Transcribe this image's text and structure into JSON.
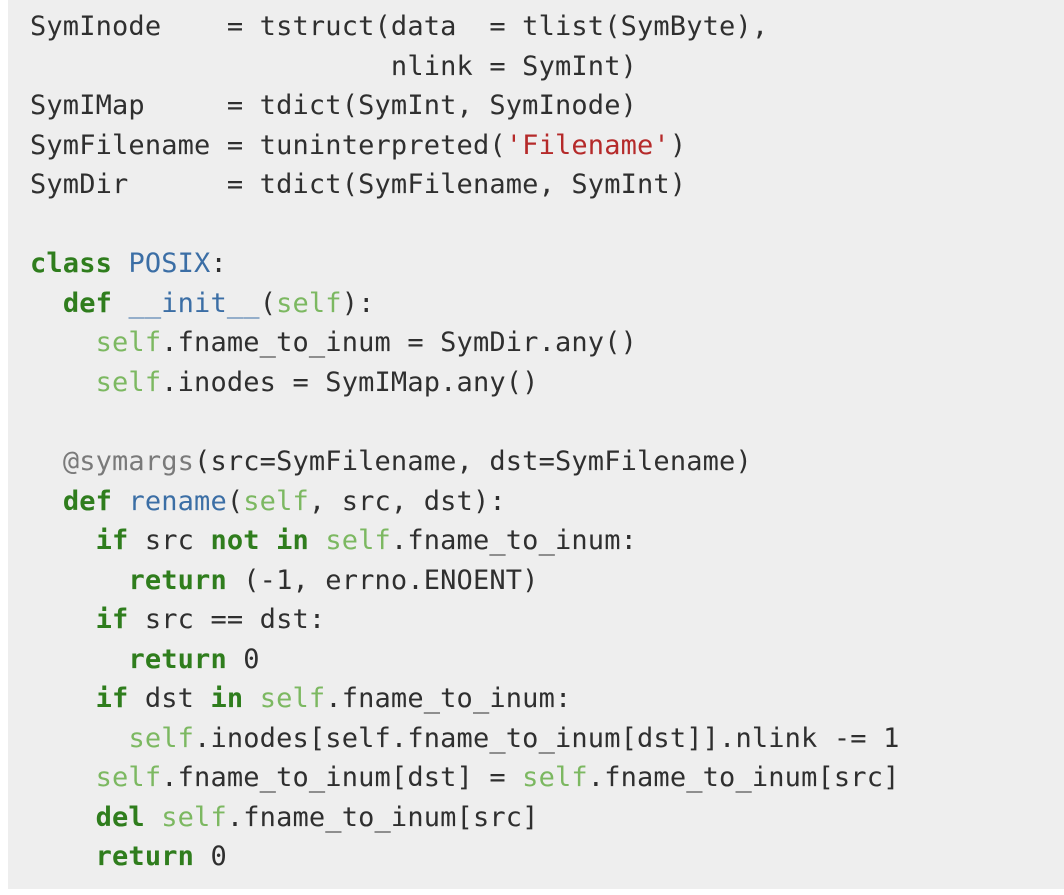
{
  "code": {
    "lines": [
      [
        {
          "t": "SymInode    = tstruct(data  = tlist(SymByte),",
          "c": ""
        }
      ],
      [
        {
          "t": "                      nlink = SymInt)",
          "c": ""
        }
      ],
      [
        {
          "t": "SymIMap     = tdict(SymInt, SymInode)",
          "c": ""
        }
      ],
      [
        {
          "t": "SymFilename = tuninterpreted(",
          "c": ""
        },
        {
          "t": "'Filename'",
          "c": "str"
        },
        {
          "t": ")",
          "c": ""
        }
      ],
      [
        {
          "t": "SymDir      = tdict(SymFilename, SymInt)",
          "c": ""
        }
      ],
      [
        {
          "t": "",
          "c": ""
        }
      ],
      [
        {
          "t": "class",
          "c": "kw"
        },
        {
          "t": " ",
          "c": ""
        },
        {
          "t": "POSIX",
          "c": "def-name"
        },
        {
          "t": ":",
          "c": ""
        }
      ],
      [
        {
          "t": "  ",
          "c": ""
        },
        {
          "t": "def",
          "c": "kw"
        },
        {
          "t": " ",
          "c": ""
        },
        {
          "t": "__init__",
          "c": "def-name"
        },
        {
          "t": "(",
          "c": ""
        },
        {
          "t": "self",
          "c": "selfkw"
        },
        {
          "t": "):",
          "c": ""
        }
      ],
      [
        {
          "t": "    ",
          "c": ""
        },
        {
          "t": "self",
          "c": "selfkw"
        },
        {
          "t": ".fname_to_inum = SymDir.any()",
          "c": ""
        }
      ],
      [
        {
          "t": "    ",
          "c": ""
        },
        {
          "t": "self",
          "c": "selfkw"
        },
        {
          "t": ".inodes = SymIMap.any()",
          "c": ""
        }
      ],
      [
        {
          "t": "",
          "c": ""
        }
      ],
      [
        {
          "t": "  ",
          "c": ""
        },
        {
          "t": "@symargs",
          "c": "deco"
        },
        {
          "t": "(src=SymFilename, dst=SymFilename)",
          "c": ""
        }
      ],
      [
        {
          "t": "  ",
          "c": ""
        },
        {
          "t": "def",
          "c": "kw"
        },
        {
          "t": " ",
          "c": ""
        },
        {
          "t": "rename",
          "c": "def-name"
        },
        {
          "t": "(",
          "c": ""
        },
        {
          "t": "self",
          "c": "selfkw"
        },
        {
          "t": ", src, dst):",
          "c": ""
        }
      ],
      [
        {
          "t": "    ",
          "c": ""
        },
        {
          "t": "if",
          "c": "kw"
        },
        {
          "t": " src ",
          "c": ""
        },
        {
          "t": "not",
          "c": "kw"
        },
        {
          "t": " ",
          "c": ""
        },
        {
          "t": "in",
          "c": "kw"
        },
        {
          "t": " ",
          "c": ""
        },
        {
          "t": "self",
          "c": "selfkw"
        },
        {
          "t": ".fname_to_inum:",
          "c": ""
        }
      ],
      [
        {
          "t": "      ",
          "c": ""
        },
        {
          "t": "return",
          "c": "kw"
        },
        {
          "t": " (-1, errno.ENOENT)",
          "c": ""
        }
      ],
      [
        {
          "t": "    ",
          "c": ""
        },
        {
          "t": "if",
          "c": "kw"
        },
        {
          "t": " src == dst:",
          "c": ""
        }
      ],
      [
        {
          "t": "      ",
          "c": ""
        },
        {
          "t": "return",
          "c": "kw"
        },
        {
          "t": " 0",
          "c": ""
        }
      ],
      [
        {
          "t": "    ",
          "c": ""
        },
        {
          "t": "if",
          "c": "kw"
        },
        {
          "t": " dst ",
          "c": ""
        },
        {
          "t": "in",
          "c": "kw"
        },
        {
          "t": " ",
          "c": ""
        },
        {
          "t": "self",
          "c": "selfkw"
        },
        {
          "t": ".fname_to_inum:",
          "c": ""
        }
      ],
      [
        {
          "t": "      ",
          "c": ""
        },
        {
          "t": "self",
          "c": "selfkw"
        },
        {
          "t": ".inodes[self.fname_to_inum[dst]].nlink -= 1",
          "c": ""
        }
      ],
      [
        {
          "t": "    ",
          "c": ""
        },
        {
          "t": "self",
          "c": "selfkw"
        },
        {
          "t": ".fname_to_inum[dst] = ",
          "c": ""
        },
        {
          "t": "self",
          "c": "selfkw"
        },
        {
          "t": ".fname_to_inum[src]",
          "c": ""
        }
      ],
      [
        {
          "t": "    ",
          "c": ""
        },
        {
          "t": "del",
          "c": "kw"
        },
        {
          "t": " ",
          "c": ""
        },
        {
          "t": "self",
          "c": "selfkw"
        },
        {
          "t": ".fname_to_inum[src]",
          "c": ""
        }
      ],
      [
        {
          "t": "    ",
          "c": ""
        },
        {
          "t": "return",
          "c": "kw"
        },
        {
          "t": " 0",
          "c": ""
        }
      ]
    ]
  },
  "colors": {
    "background": "#eeeeee",
    "text": "#2f2f2f",
    "keyword": "#2f7d1d",
    "self": "#7cb861",
    "name": "#3b6ea5",
    "string": "#b52a2a",
    "decorator": "#7a7a7a"
  }
}
